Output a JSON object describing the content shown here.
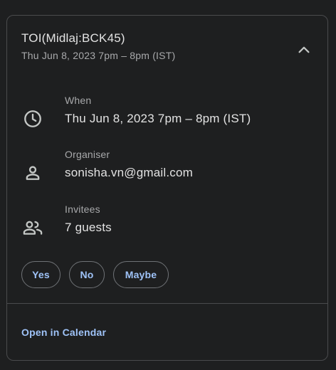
{
  "event": {
    "title": "TOI(Midlaj:BCK45)",
    "subtitle": "Thu Jun 8, 2023 7pm – 8pm (IST)"
  },
  "details": {
    "when": {
      "label": "When",
      "value": "Thu Jun 8, 2023 7pm – 8pm (IST)",
      "icon": "clock-icon"
    },
    "organiser": {
      "label": "Organiser",
      "value": "sonisha.vn@gmail.com",
      "icon": "person-icon"
    },
    "invitees": {
      "label": "Invitees",
      "value": "7 guests",
      "icon": "people-icon"
    }
  },
  "rsvp": {
    "yes": "Yes",
    "no": "No",
    "maybe": "Maybe"
  },
  "footer": {
    "open_calendar": "Open in Calendar"
  },
  "colors": {
    "background": "#1e1f20",
    "border": "#4a4b4d",
    "text_primary": "#e3e3e3",
    "text_secondary": "#a8a9ab",
    "accent": "#9fc3f8"
  }
}
